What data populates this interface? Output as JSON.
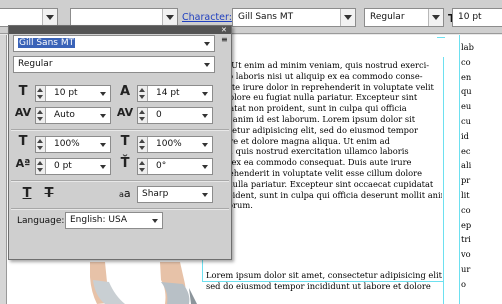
{
  "options_bar": {
    "character_label": "Character:",
    "font_family": "Gill Sans MT",
    "font_style": "Regular",
    "font_size": "10 pt"
  },
  "character_panel": {
    "font_family": "Gill Sans MT",
    "font_style": "Regular",
    "font_size": "10 pt",
    "leading": "14 pt",
    "kerning": "Auto",
    "tracking": "0",
    "vertical_scale": "100%",
    "horizontal_scale": "100%",
    "baseline_shift": "0 pt",
    "rotation": "0°",
    "antialias": "Sharp",
    "language_label": "Language:",
    "language_value": "English: USA",
    "antialias_icon_text": "a",
    "antialias_icon_text2": "a"
  },
  "document": {
    "main_text_lines": [
      "aliqua. Ut enim ad minim veniam, quis nostrud exerci-",
      "ullamco laboris nisi ut aliquip ex ea commodo conse-",
      "Duis aute irure dolor in reprehenderit in voluptate velit",
      "illum dolore eu fugiat nulla pariatur. Excepteur sint",
      "t cupidatat non proident, sunt in culpa qui officia",
      "t mollit anim id est laborum. Lorem ipsum dolor sit",
      "consectetur adipisicing elit, sed do eiusmod tempor",
      "ut labore et dolore magna aliqua. Ut enim ad",
      "veniam, quis nostrud exercitation ullamco laboris",
      "aliquip ex ea commodo consequat. Duis aute irure",
      "in reprehenderit in voluptate velit esse cillum dolore",
      "fugiat nulla pariatur. Excepteur sint occaecat cupidatat",
      "non proident, sunt in culpa qui officia deserunt mollit anim",
      "est laborum."
    ],
    "lower_text_lines": [
      "Lorem ipsum dolor sit amet, consectetur adipisicing elit,",
      "sed do eiusmod tempor incididunt ut labore et dolore"
    ],
    "right_col_lines": [
      "lab",
      "co",
      "en",
      "qu",
      "eu",
      "cu",
      "id",
      "ec",
      "ali",
      "pr",
      "lit",
      "co",
      "ep",
      "tri",
      "vo",
      "ur",
      "o"
    ]
  }
}
